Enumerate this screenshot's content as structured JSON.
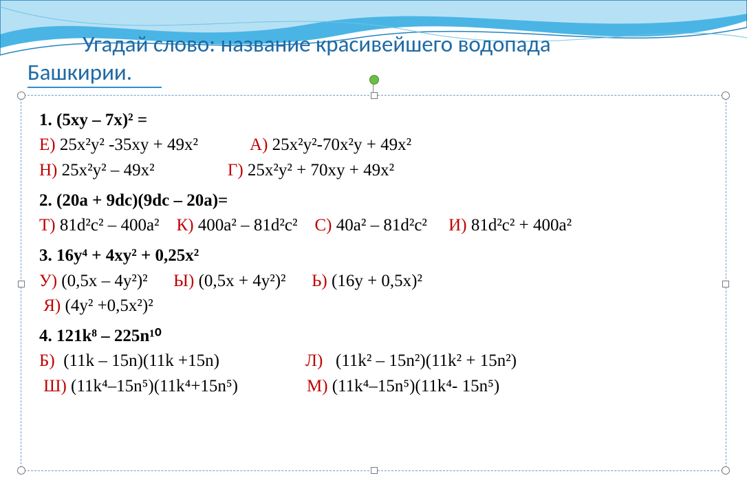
{
  "title_line1": "Угадай слово: название красивейшего водопада",
  "title_line2": "Башкирии.",
  "q1": {
    "prompt_label": "1.",
    "prompt_expr": "(5xy – 7x)² =",
    "answers": {
      "E": {
        "letter": "Е)",
        "text": "25x²y² ‑35xy + 49x²"
      },
      "A": {
        "letter": "А)",
        "text": "25x²y²‑70x²y + 49x²"
      },
      "N": {
        "letter": "Н)",
        "text": "25x²y² – 49x²"
      },
      "G": {
        "letter": "Г)",
        "text": "25x²y² + 70xy + 49x²"
      }
    }
  },
  "q2": {
    "prompt_label": "2.",
    "prompt_expr": "(20a + 9dc)(9dc – 20a)=",
    "answers": {
      "T": {
        "letter": "Т)",
        "text": "81d²c² – 400a²"
      },
      "K": {
        "letter": "К)",
        "text": "400a² – 81d²c²"
      },
      "S": {
        "letter": "С)",
        "text": "40a² – 81d²c²"
      },
      "I": {
        "letter": "И)",
        "text": "81d²c² + 400a²"
      }
    }
  },
  "q3": {
    "prompt_label": "3.",
    "prompt_expr": "16y⁴ + 4xy² + 0,25x²",
    "answers": {
      "U": {
        "letter": "У)",
        "text": "(0,5x – 4y²)²"
      },
      "Yi": {
        "letter": "Ы)",
        "text": "(0,5x + 4y²)²"
      },
      "Soft": {
        "letter": "Ь)",
        "text": "(16y + 0,5x)²"
      },
      "Ya": {
        "letter": "Я)",
        "text": "(4y² +0,5x²)²"
      }
    }
  },
  "q4": {
    "prompt_label": "4.",
    "prompt_expr": "121k⁸ – 225n¹⁰",
    "answers": {
      "B": {
        "letter": "Б)",
        "text": "(11k – 15n)(11k +15n)"
      },
      "L": {
        "letter": "Л)",
        "text": "(11k² – 15n²)(11k² + 15n²)"
      },
      "Sh": {
        "letter": "Ш)",
        "text": "(11k⁴–15n⁵)(11k⁴+15n⁵)"
      },
      "M": {
        "letter": "М)",
        "text": "(11k⁴–15n⁵)(11k⁴‑ 15n⁵)"
      }
    }
  }
}
